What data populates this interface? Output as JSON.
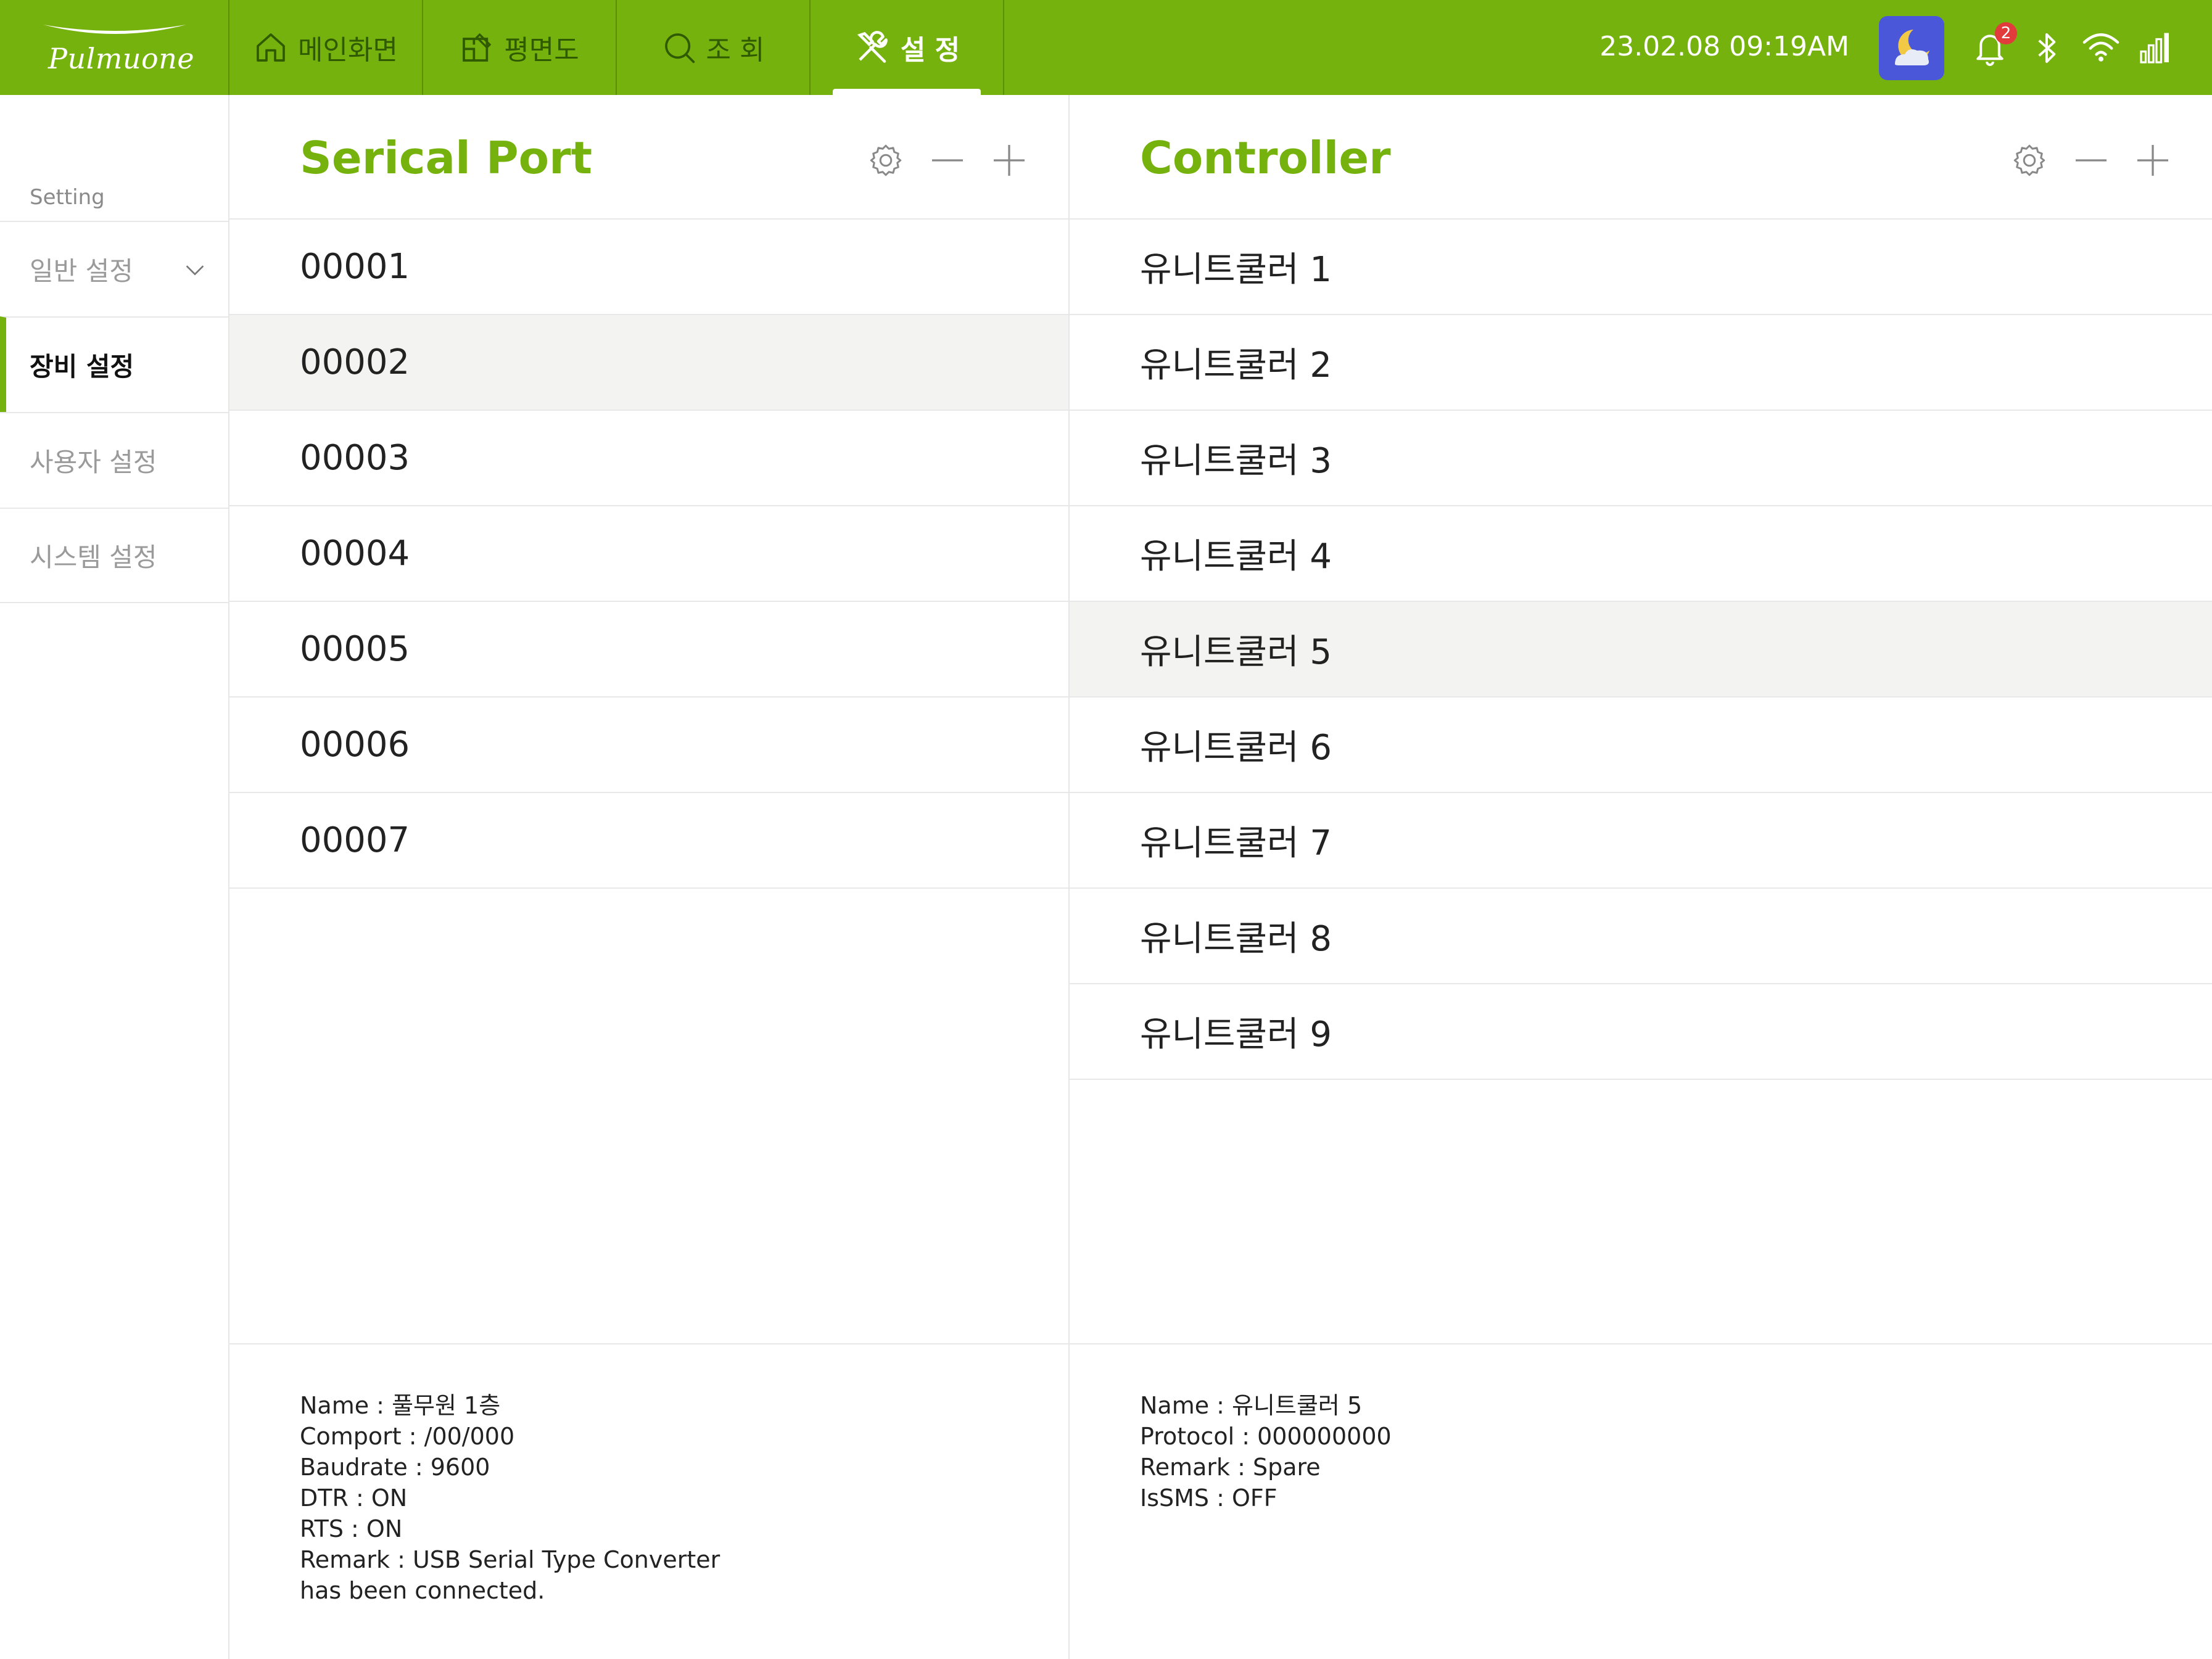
{
  "header": {
    "logo_text": "Pulmuone",
    "nav_tabs": [
      {
        "label": "메인화면",
        "icon": "home-icon"
      },
      {
        "label": "평면도",
        "icon": "floorplan-icon"
      },
      {
        "label": "조 회",
        "icon": "search-icon"
      },
      {
        "label": "설 정",
        "icon": "settings-tools-icon",
        "active": true
      }
    ],
    "datetime": "23.02.08  09:19AM",
    "notification_count": "2",
    "status_icons": [
      "weather-night-icon",
      "bell-icon",
      "bluetooth-icon",
      "wifi-icon",
      "signal-icon"
    ]
  },
  "colors": {
    "accent": "#76b20e",
    "weather_bg": "#4a57d8",
    "badge": "#e23b3b"
  },
  "sidebar": {
    "caption": "Setting",
    "items": [
      {
        "label": "일반 설정",
        "has_chevron": true
      },
      {
        "label": "장비 설정",
        "active": true
      },
      {
        "label": "사용자 설정"
      },
      {
        "label": "시스템 설정"
      }
    ]
  },
  "serial_port": {
    "title": "Serical Port",
    "items": [
      "00001",
      "00002",
      "00003",
      "00004",
      "00005",
      "00006",
      "00007"
    ],
    "selected": "00002",
    "detail": [
      "Name : 풀무원 1층",
      "Comport : /00/000",
      "Baudrate : 9600",
      "DTR : ON",
      "RTS : ON",
      "Remark : USB Serial Type Converter",
      "has been connected."
    ]
  },
  "controller": {
    "title": "Controller",
    "items": [
      "유니트쿨러 1",
      "유니트쿨러 2",
      "유니트쿨러 3",
      "유니트쿨러 4",
      "유니트쿨러 5",
      "유니트쿨러 6",
      "유니트쿨러 7",
      "유니트쿨러 8",
      "유니트쿨러 9"
    ],
    "selected": "유니트쿨러 5",
    "detail": [
      "Name : 유니트쿨러 5",
      "Protocol : 000000000",
      "Remark : Spare",
      "IsSMS : OFF"
    ]
  }
}
